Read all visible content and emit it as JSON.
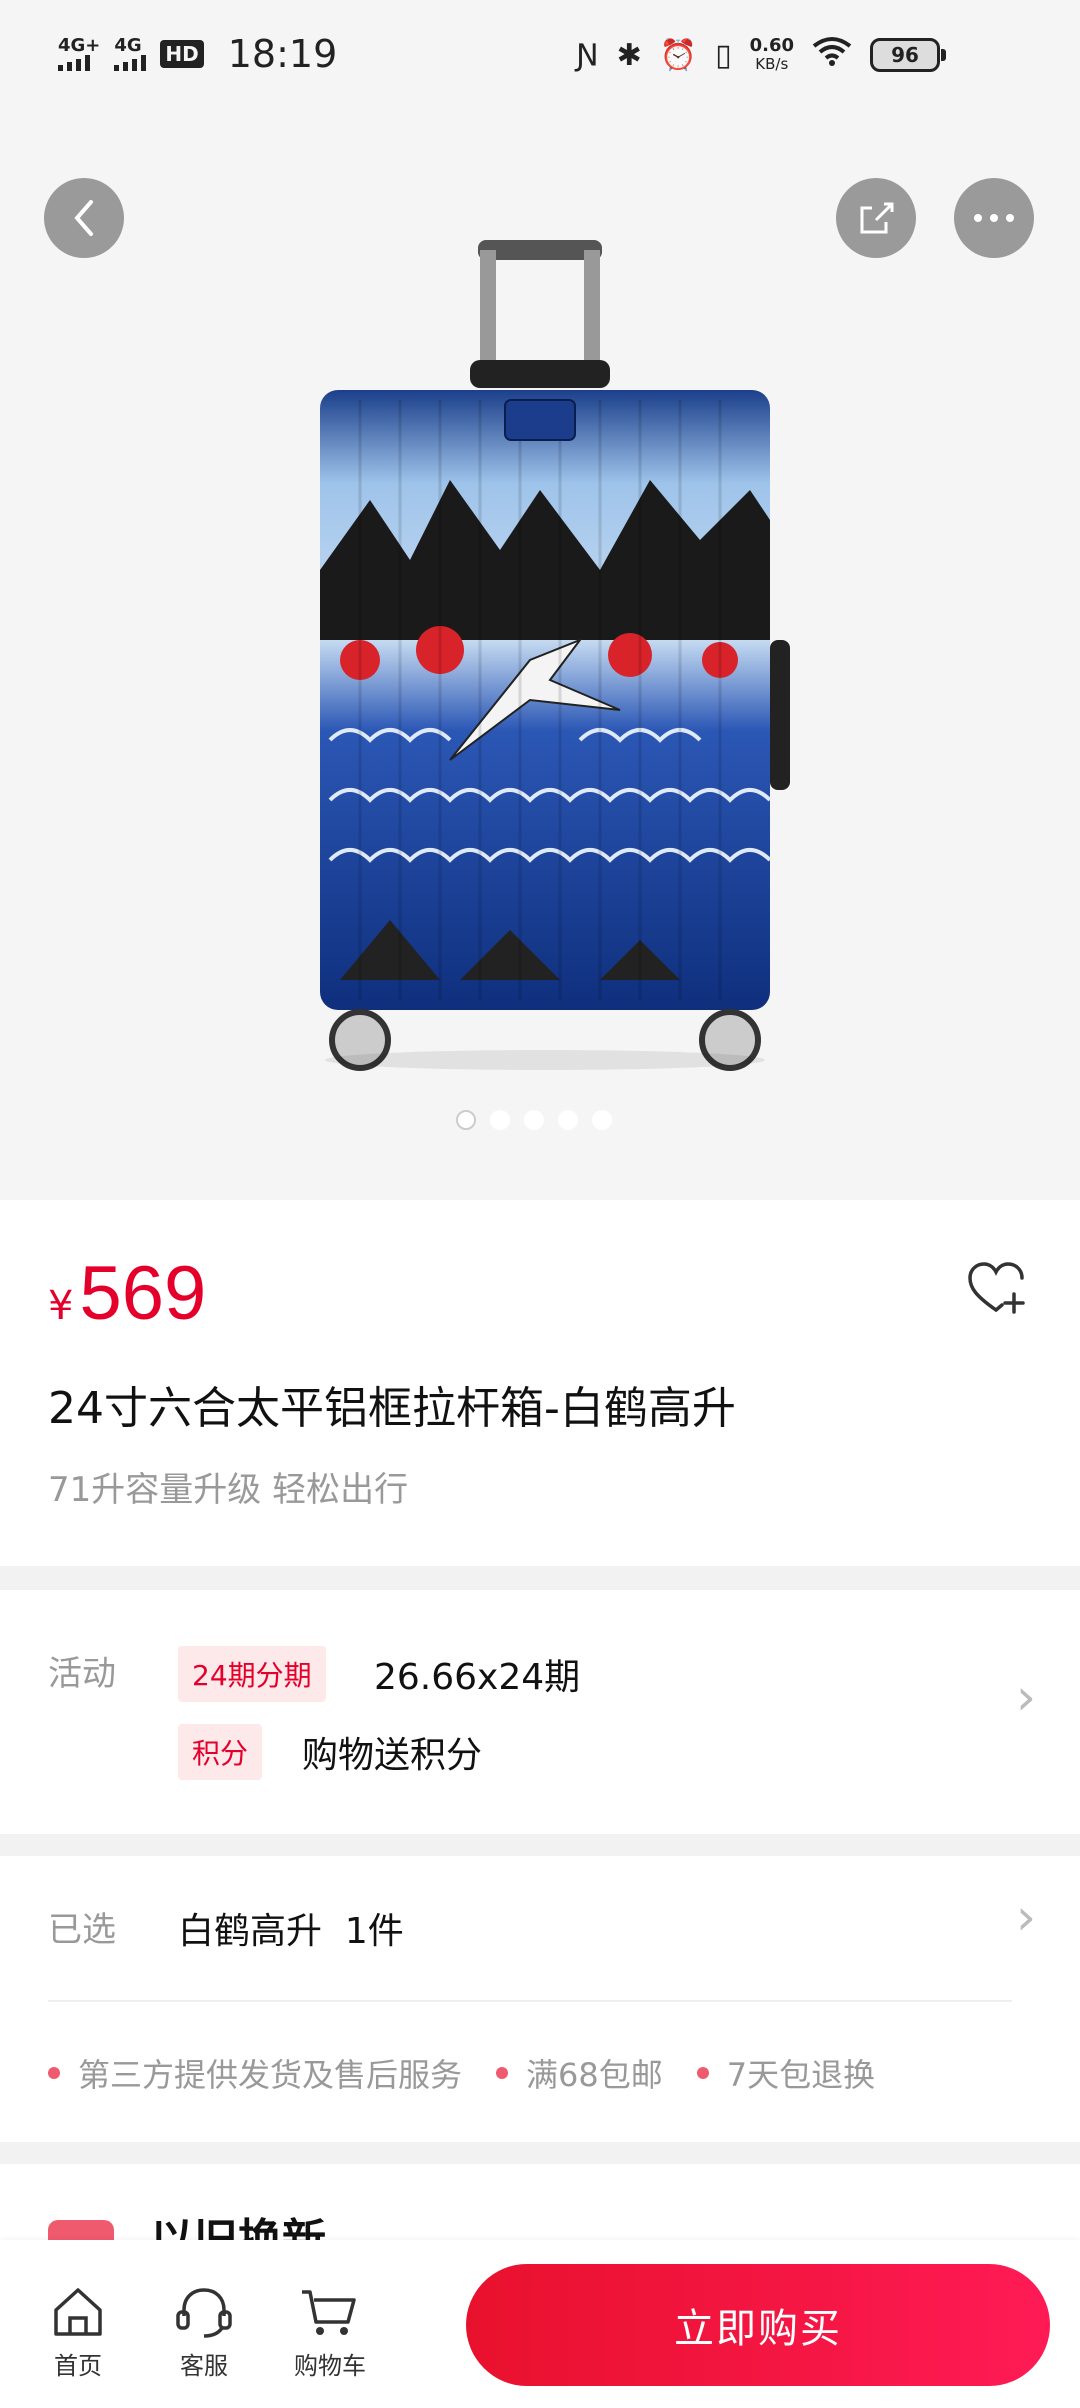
{
  "status_bar": {
    "net1": "4G+",
    "net2": "4G",
    "hd": "HD",
    "time": "18:19",
    "speed_value": "0.60",
    "speed_unit": "KB/s",
    "battery": "96"
  },
  "product": {
    "price_currency": "¥",
    "price": "569",
    "title": "24寸六合太平铝框拉杆箱-白鹤高升",
    "subtitle": "71升容量升级 轻松出行",
    "image_count": 5,
    "image_active_index": 0
  },
  "promotions": {
    "label": "活动",
    "items": [
      {
        "tag": "24期分期",
        "text": "26.66x24期"
      },
      {
        "tag": "积分",
        "text": "购物送积分"
      }
    ]
  },
  "selection": {
    "label": "已选",
    "value": "白鹤高升  1件"
  },
  "services": [
    "第三方提供发货及售后服务",
    "满68包邮",
    "7天包退换"
  ],
  "trade_in": {
    "title": "以旧换新"
  },
  "bottom_nav": {
    "home": "首页",
    "service": "客服",
    "cart": "购物车",
    "buy": "立即购买"
  },
  "colors": {
    "accent": "#e4002b",
    "tag_bg": "#fde8ea",
    "buy_gradient_start": "#e8112d",
    "buy_gradient_end": "#ff1a55"
  },
  "icons": [
    "back-icon",
    "share-icon",
    "more-icon",
    "favorite-add-icon",
    "chevron-right-icon",
    "home-icon",
    "headset-icon",
    "cart-icon"
  ]
}
